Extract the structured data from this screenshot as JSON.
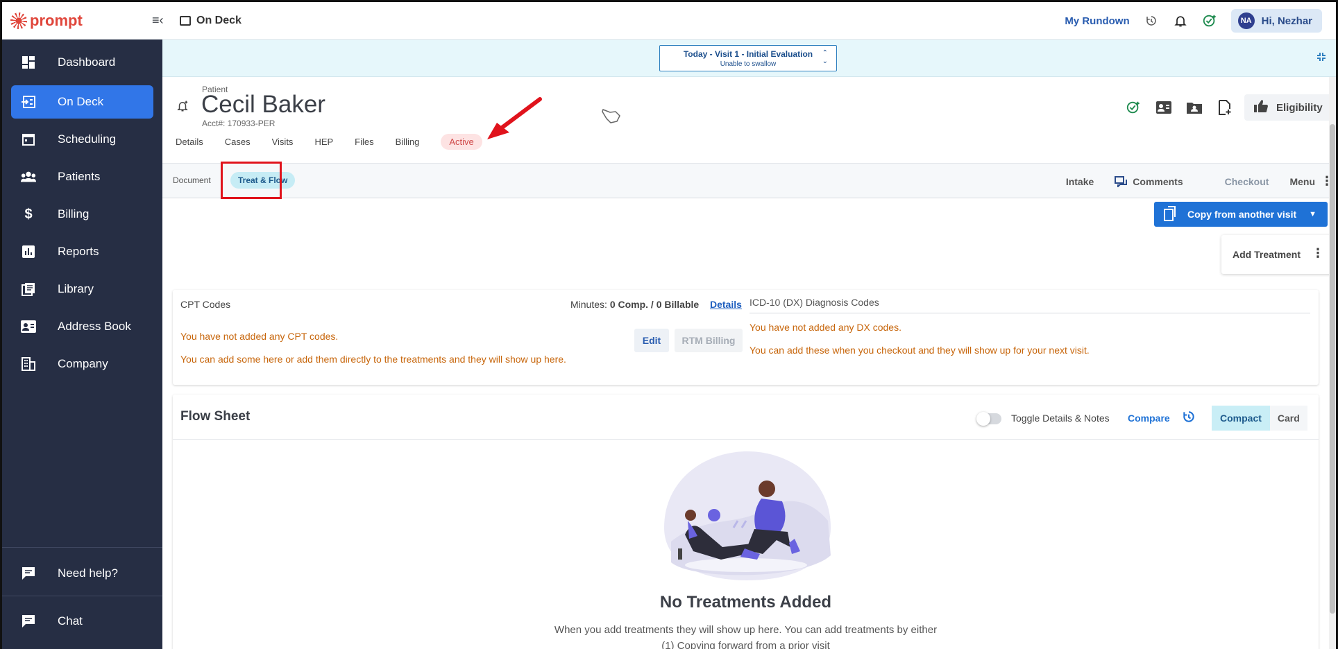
{
  "app": {
    "brand": "prompt",
    "current_page": "On Deck"
  },
  "topbar": {
    "rundown_label": "My Rundown",
    "user_initials": "NA",
    "user_greeting": "Hi, Nezhar"
  },
  "sidebar": {
    "items": [
      {
        "label": "Dashboard",
        "icon": "dashboard-icon"
      },
      {
        "label": "On Deck",
        "icon": "on-deck-icon",
        "active": true
      },
      {
        "label": "Scheduling",
        "icon": "calendar-icon"
      },
      {
        "label": "Patients",
        "icon": "people-icon"
      },
      {
        "label": "Billing",
        "icon": "dollar-icon"
      },
      {
        "label": "Reports",
        "icon": "chart-icon"
      },
      {
        "label": "Library",
        "icon": "library-icon"
      },
      {
        "label": "Address Book",
        "icon": "address-book-icon"
      },
      {
        "label": "Company",
        "icon": "building-icon"
      }
    ],
    "help_label": "Need help?",
    "chat_label": "Chat"
  },
  "visit": {
    "title": "Today - Visit 1 - Initial Evaluation",
    "subtitle": "Unable to swallow"
  },
  "patient": {
    "label": "Patient",
    "name": "Cecil Baker",
    "acct": "Acct#: 170933-PER",
    "tabs": [
      "Details",
      "Cases",
      "Visits",
      "HEP",
      "Files",
      "Billing"
    ],
    "status": "Active",
    "eligibility_label": "Eligibility"
  },
  "docbar": {
    "document_label": "Document",
    "treat_flow_label": "Treat & Flow",
    "intake_label": "Intake",
    "comments_label": "Comments",
    "checkout_label": "Checkout",
    "menu_label": "Menu"
  },
  "actions": {
    "copy_label": "Copy from another visit",
    "add_treatment_label": "Add Treatment"
  },
  "cpt": {
    "title": "CPT Codes",
    "minutes_prefix": "Minutes:",
    "minutes_value": "0 Comp. / 0 Billable",
    "details_link": "Details",
    "empty_line1": "You have not added any CPT codes.",
    "empty_line2": "You can add some here or add them directly to the treatments and they will show up here.",
    "edit_label": "Edit",
    "rtm_label": "RTM Billing"
  },
  "icd": {
    "title": "ICD-10 (DX) Diagnosis Codes",
    "empty_line1": "You have not added any DX codes.",
    "empty_line2": "You can add these when you checkout and they will show up for your next visit."
  },
  "flow": {
    "title": "Flow Sheet",
    "toggle_label": "Toggle Details & Notes",
    "compare_label": "Compare",
    "view_compact": "Compact",
    "view_card": "Card",
    "empty_title": "No Treatments Added",
    "empty_text_1": "When you add treatments they will show up here. You can add treatments by either",
    "empty_text_2": "(1) Copying forward from a prior visit"
  }
}
